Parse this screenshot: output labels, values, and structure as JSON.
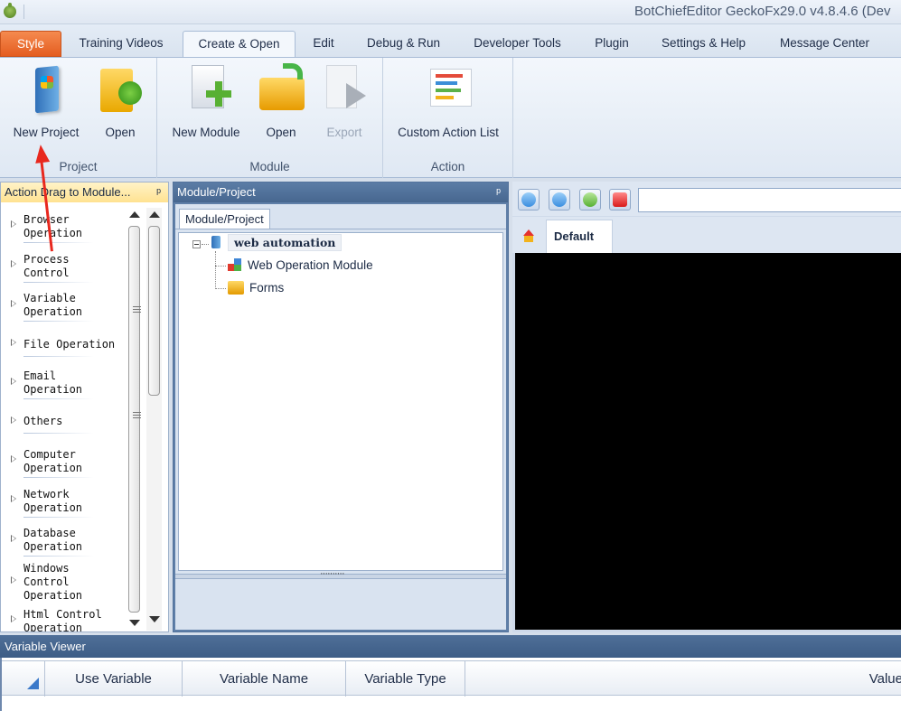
{
  "window": {
    "title": "BotChiefEditor GeckoFx29.0 v4.8.4.6 (Dev"
  },
  "ribbon_tabs": [
    {
      "label": "Style"
    },
    {
      "label": "Training Videos"
    },
    {
      "label": "Create & Open"
    },
    {
      "label": "Edit"
    },
    {
      "label": "Debug & Run"
    },
    {
      "label": "Developer Tools"
    },
    {
      "label": "Plugin"
    },
    {
      "label": "Settings & Help"
    },
    {
      "label": "Message Center"
    }
  ],
  "ribbon": {
    "groups": {
      "project": {
        "label": "Project",
        "new_project": "New Project",
        "open": "Open"
      },
      "module": {
        "label": "Module",
        "new_module": "New Module",
        "open": "Open",
        "export": "Export"
      },
      "action": {
        "label": "Action",
        "custom_action_list": "Custom Action List"
      }
    }
  },
  "left_panel": {
    "title": "Action Drag to Module...",
    "pin": "ᵖ",
    "items": [
      {
        "label": "Browser\nOperation"
      },
      {
        "label": "Process\nControl"
      },
      {
        "label": "Variable\nOperation"
      },
      {
        "label": "File Operation"
      },
      {
        "label": "Email\nOperation"
      },
      {
        "label": "Others"
      },
      {
        "label": "Computer\nOperation"
      },
      {
        "label": "Network\nOperation"
      },
      {
        "label": "Database\nOperation"
      },
      {
        "label": "Windows\nControl\nOperation"
      },
      {
        "label": "Html Control\nOperation"
      }
    ]
  },
  "mid_panel": {
    "title": "Module/Project",
    "pin": "ᵖ",
    "tab": "Module/Project",
    "tree": {
      "root": "web automation",
      "children": [
        "Web Operation Module",
        "Forms"
      ]
    },
    "splitter_dots": "··········"
  },
  "browser": {
    "url": "",
    "tab": "Default"
  },
  "variable_viewer": {
    "title": "Variable Viewer",
    "columns": [
      "Use Variable",
      "Variable Name",
      "Variable Type",
      "Value"
    ]
  },
  "colors": {
    "style_tab": "#e45d20",
    "panel_header": "#4a6a92",
    "annotation_arrow": "#e8281e"
  }
}
